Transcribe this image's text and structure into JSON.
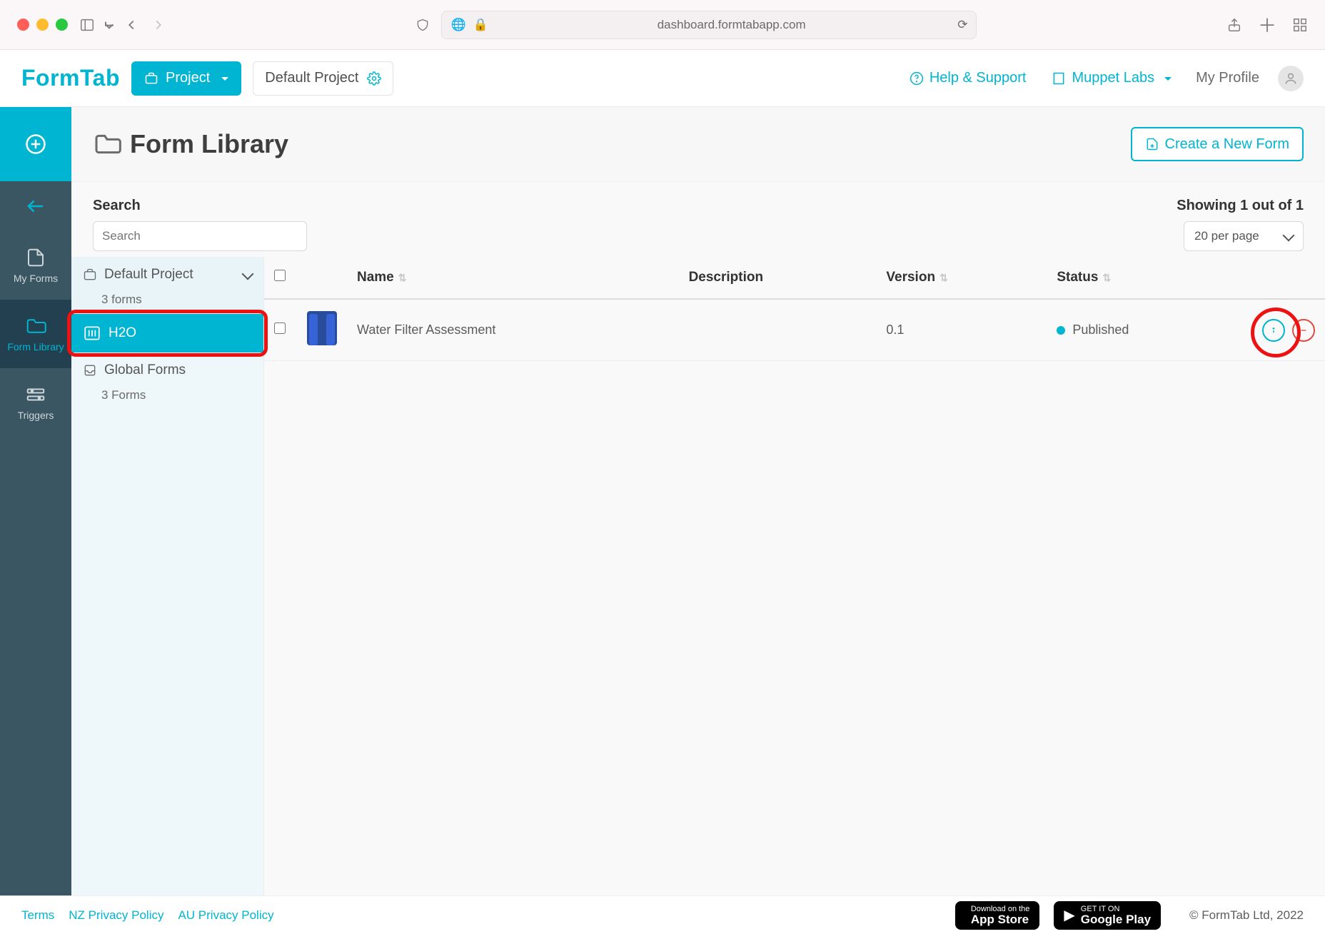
{
  "browser": {
    "url": "dashboard.formtabapp.com"
  },
  "header": {
    "logo": "FormTab",
    "project_label": "Project",
    "default_project": "Default Project",
    "help": "Help & Support",
    "org": "Muppet Labs",
    "profile": "My Profile"
  },
  "vnav": {
    "my_forms": "My Forms",
    "form_library": "Form Library",
    "triggers": "Triggers"
  },
  "page": {
    "title": "Form Library",
    "create_btn": "Create a New Form"
  },
  "search": {
    "label": "Search",
    "placeholder": "Search",
    "showing": "Showing 1 out of 1",
    "per_page": "20 per page"
  },
  "tree": {
    "project_head": "Default Project",
    "project_sub": "3 forms",
    "active_item": "H2O",
    "global": "Global Forms",
    "global_sub": "3 Forms"
  },
  "table": {
    "cols": {
      "name": "Name",
      "description": "Description",
      "version": "Version",
      "status": "Status"
    },
    "rows": [
      {
        "name": "Water Filter Assessment",
        "description": "",
        "version": "0.1",
        "status": "Published"
      }
    ]
  },
  "footer": {
    "terms": "Terms",
    "nz": "NZ Privacy Policy",
    "au": "AU Privacy Policy",
    "appstore_top": "Download on the",
    "appstore": "App Store",
    "play_top": "GET IT ON",
    "play": "Google Play",
    "copyright": "© FormTab Ltd, 2022"
  }
}
